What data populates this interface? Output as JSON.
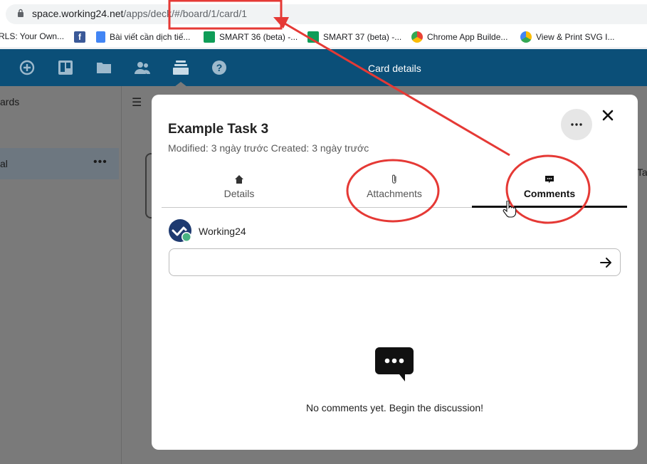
{
  "browser": {
    "url_host": "space.working24.net",
    "url_path": "/apps/deck/",
    "url_hash": "#/board/1/card/1"
  },
  "bookmarks": [
    {
      "label": "RLS: Your Own...",
      "icon": "link-icon",
      "color": "#ffffff"
    },
    {
      "label": "Bài viết cần dịch tiế...",
      "icon": "google-docs-icon",
      "color": "#4285f4"
    },
    {
      "label": "SMART 36 (beta) -...",
      "icon": "google-sheets-icon",
      "color": "#0f9d58"
    },
    {
      "label": "SMART 37 (beta) -...",
      "icon": "google-sheets-icon",
      "color": "#0f9d58"
    },
    {
      "label": "Chrome App Builde...",
      "icon": "chrome-icon",
      "color": "#ea4335"
    },
    {
      "label": "View & Print SVG I...",
      "icon": "chrome-icon",
      "color": "#fbbc05"
    }
  ],
  "app_header": {
    "title": "Card details",
    "icons": [
      "add-icon",
      "deck-board-icon",
      "folder-icon",
      "contacts-icon",
      "deck-stack-icon",
      "help-icon"
    ]
  },
  "sidebar": {
    "heading_fragment": "ards",
    "selected_fragment": "al",
    "menu_glyph": "•••"
  },
  "background": {
    "right_fragment": "Ta"
  },
  "card": {
    "title": "Example Task 3",
    "meta": "Modified: 3 ngày trước Created: 3 ngày trước",
    "close_glyph": "✕",
    "tabs": [
      {
        "label": "Details",
        "icon": "home-icon",
        "active": false
      },
      {
        "label": "Attachments",
        "icon": "paperclip-icon",
        "active": false
      },
      {
        "label": "Comments",
        "icon": "comment-icon",
        "active": true
      }
    ],
    "comment_author": "Working24",
    "comment_placeholder": "",
    "empty_message": "No comments yet. Begin the discussion!"
  },
  "colors": {
    "header_bg": "#0b4f78",
    "annotation_red": "#e53935",
    "overlay": "#7a7a7a"
  }
}
